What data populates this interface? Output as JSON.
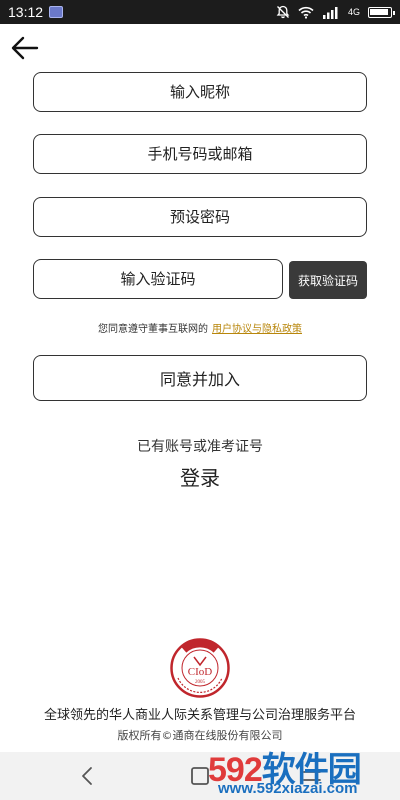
{
  "status_bar": {
    "time": "13:12",
    "network": "4G"
  },
  "form": {
    "nickname_placeholder": "输入昵称",
    "account_placeholder": "手机号码或邮箱",
    "password_placeholder": "预设密码",
    "captcha_placeholder": "输入验证码",
    "get_captcha_label": "获取验证码"
  },
  "agreement": {
    "prefix": "您同意遵守董事互联网的",
    "link": "用户协议与隐私政策"
  },
  "join_label": "同意并加入",
  "existing_account_text": "已有账号或准考证号",
  "login_label": "登录",
  "footer": {
    "logo_text": "CIoD",
    "logo_year": "2005",
    "slogan": "全球领先的华人商业人际关系管理与公司治理服务平台",
    "copyright": "版权所有©通商在线股份有限公司"
  },
  "watermark": {
    "main_num": "592",
    "main_text": "软件园",
    "sub": "www.592xiazai.com"
  },
  "colors": {
    "link": "#b8860b",
    "button_dark": "#3a3a3a",
    "status_bar": "#1c1c1c"
  }
}
